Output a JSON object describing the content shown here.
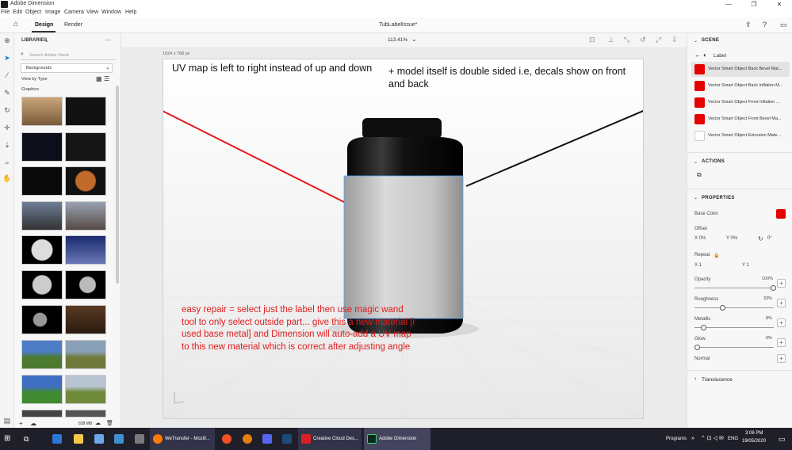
{
  "window": {
    "title": "Adobe Dimension"
  },
  "menu": [
    "File",
    "Edit",
    "Object",
    "Image",
    "Camera",
    "View",
    "Window",
    "Help"
  ],
  "toolbar": {
    "tabs": [
      "Design",
      "Render"
    ],
    "doc_title": "TubLabelIssue*",
    "zoom": "113.41%",
    "viewport_size": "1024 x 768 px"
  },
  "libraries": {
    "title": "LIBRARIES",
    "search_placeholder": "Search Adobe Stock",
    "dropdown": "Backgrounds",
    "view_by": "View by Type",
    "section": "Graphics",
    "storage": "838 MB"
  },
  "annotations": {
    "uv": "UV map is left to right instead of up and down",
    "double_sided": "+ model itself is double sided i.e, decals show on front and back",
    "repair": "easy repair = select just the label then use magic wand tool to only select outside part... give this a new material [i used base metal] and Dimension will auto-add a UV map to this new material which is correct after adjusting angle"
  },
  "scene": {
    "header": "SCENE",
    "crumb": "Label",
    "materials": [
      {
        "label": "Vector Smart Object Back Bevel Mat...",
        "color": "#e60000"
      },
      {
        "label": "Vector Smart Object Back Inflation M...",
        "color": "#e60000"
      },
      {
        "label": "Vector Smart Object Front Inflation ...",
        "color": "#e60000"
      },
      {
        "label": "Vector Smart Object Front Bevel Ma...",
        "color": "#e60000"
      },
      {
        "label": "Vector Smart Object Extrusion Mate...",
        "color": "#ffffff"
      }
    ]
  },
  "actions": {
    "header": "ACTIONS"
  },
  "properties": {
    "header": "PROPERTIES",
    "base_color_label": "Base Color",
    "base_color": "#e60000",
    "offset_label": "Offset",
    "offset_x": "X  0%",
    "offset_y": "Y  0%",
    "offset_rot": "0°",
    "repeat_label": "Repeat",
    "repeat_x": "X  1",
    "repeat_y": "Y  1",
    "opacity_label": "Opacity",
    "opacity": "100%",
    "opacity_level": 1.0,
    "roughness_label": "Roughness",
    "roughness": "33%",
    "roughness_level": 0.33,
    "metallic_label": "Metallic",
    "metallic": "8%",
    "metallic_level": 0.08,
    "glow_label": "Glow",
    "glow": "0%",
    "glow_level": 0.0,
    "normal_label": "Normal",
    "translucence_label": "Translucence"
  },
  "taskbar": {
    "items": [
      "WeTransfer - Mozill...",
      "Creative Cloud Des...",
      "Adobe Dimension"
    ],
    "programs": "Programs",
    "lang": "ENG",
    "time": "3:06 PM",
    "date": "19/05/2020"
  },
  "colors": {
    "annotation_red": "#e01e1e",
    "annotation_black": "#111111",
    "accent": "#e60000"
  }
}
